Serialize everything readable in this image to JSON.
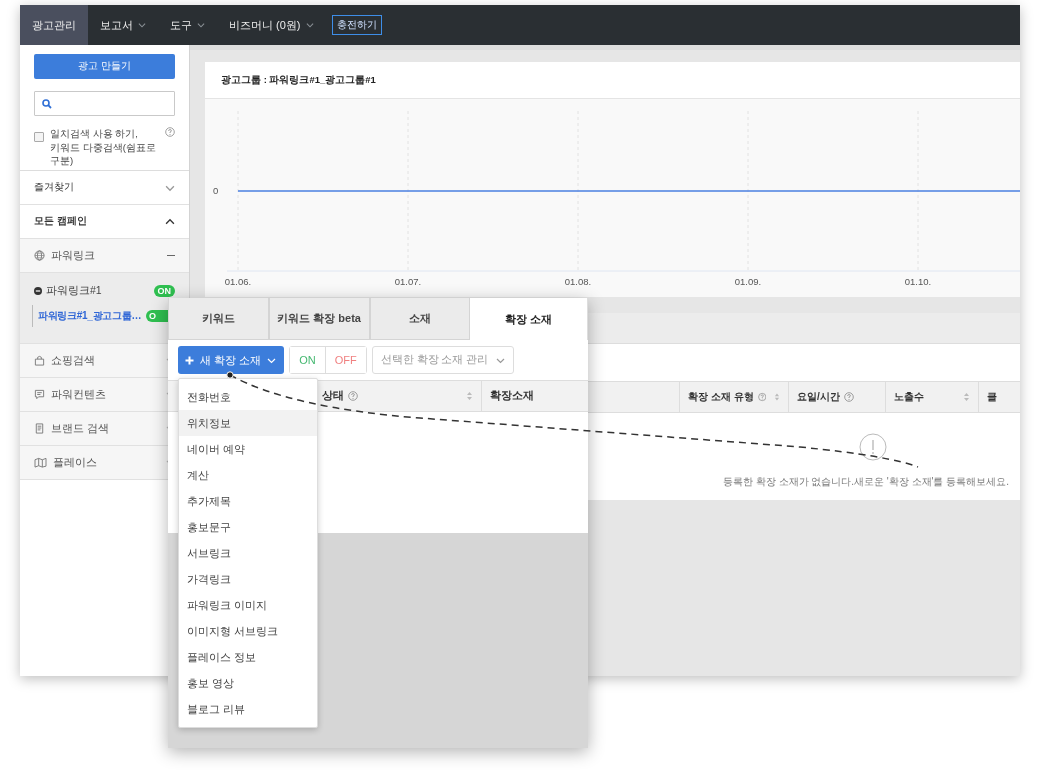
{
  "nav": {
    "items": [
      {
        "label": "광고관리",
        "selected": true,
        "dropdown": false
      },
      {
        "label": "보고서",
        "selected": false,
        "dropdown": true
      },
      {
        "label": "도구",
        "selected": false,
        "dropdown": true
      },
      {
        "label": "비즈머니 (0원)",
        "selected": false,
        "dropdown": true
      }
    ],
    "charge_button": "충전하기"
  },
  "sidebar": {
    "create_button": "광고 만들기",
    "exact_match": {
      "label": "일치검색 사용 하기,\n키워드 다중검색(쉼표로 구분)",
      "checked": false
    },
    "sections": [
      {
        "label": "즐겨찾기",
        "expanded": false
      },
      {
        "label": "모든 캠페인",
        "expanded": true
      }
    ],
    "campaigns": [
      {
        "kind": "globe",
        "label": "파워링크",
        "expanded": true,
        "children": [
          {
            "label": "파워링크#1",
            "status": "ON",
            "children": [
              {
                "label": "파워링크#1_광고그룹…",
                "status": "O",
                "selected": true
              }
            ]
          }
        ]
      },
      {
        "kind": "bag",
        "label": "쇼핑검색",
        "expanded": false
      },
      {
        "kind": "speech",
        "label": "파워컨텐츠",
        "expanded": false
      },
      {
        "kind": "doc",
        "label": "브랜드 검색",
        "expanded": false
      },
      {
        "kind": "map",
        "label": "플레이스",
        "expanded": false
      }
    ]
  },
  "chart": {
    "title": "광고그룹 : 파워링크#1_광고그룹#1",
    "zero_label": "0",
    "x_labels": [
      "01.06.",
      "01.07.",
      "01.08.",
      "01.09.",
      "01.10."
    ]
  },
  "background_table": {
    "columns": [
      {
        "label": "확장 소재 유형",
        "help": true,
        "sortable": true
      },
      {
        "label": "요일/시간",
        "help": true,
        "sortable": false
      },
      {
        "label": "노출수",
        "help": false,
        "sortable": true
      },
      {
        "label": "클",
        "help": false,
        "sortable": false
      }
    ],
    "empty_message": "등록한 확장 소재가 없습니다.새로운 '확장 소재'를 등록해보세요."
  },
  "panel": {
    "tabs": [
      {
        "label": "키워드",
        "selected": false
      },
      {
        "label": "키워드 확장 beta",
        "selected": false
      },
      {
        "label": "소재",
        "selected": false
      },
      {
        "label": "확장 소재",
        "selected": true
      }
    ],
    "new_button": "새 확장 소재",
    "on_button": "ON",
    "off_button": "OFF",
    "manage_select": "선택한 확장 소재 관리",
    "columns": [
      {
        "label": "상태",
        "help": true,
        "sortable": true
      },
      {
        "label": "확장소재",
        "help": false,
        "sortable": false
      }
    ],
    "menu": [
      {
        "label": "전화번호",
        "selected": false
      },
      {
        "label": "위치정보",
        "selected": true
      },
      {
        "label": "네이버 예약",
        "selected": false
      },
      {
        "label": "계산",
        "selected": false
      },
      {
        "label": "추가제목",
        "selected": false
      },
      {
        "label": "홍보문구",
        "selected": false
      },
      {
        "label": "서브링크",
        "selected": false
      },
      {
        "label": "가격링크",
        "selected": false
      },
      {
        "label": "파워링크 이미지",
        "selected": false
      },
      {
        "label": "이미지형 서브링크",
        "selected": false
      },
      {
        "label": "플레이스 정보",
        "selected": false
      },
      {
        "label": "홍보 영상",
        "selected": false
      },
      {
        "label": "블로그 리뷰",
        "selected": false
      }
    ]
  }
}
